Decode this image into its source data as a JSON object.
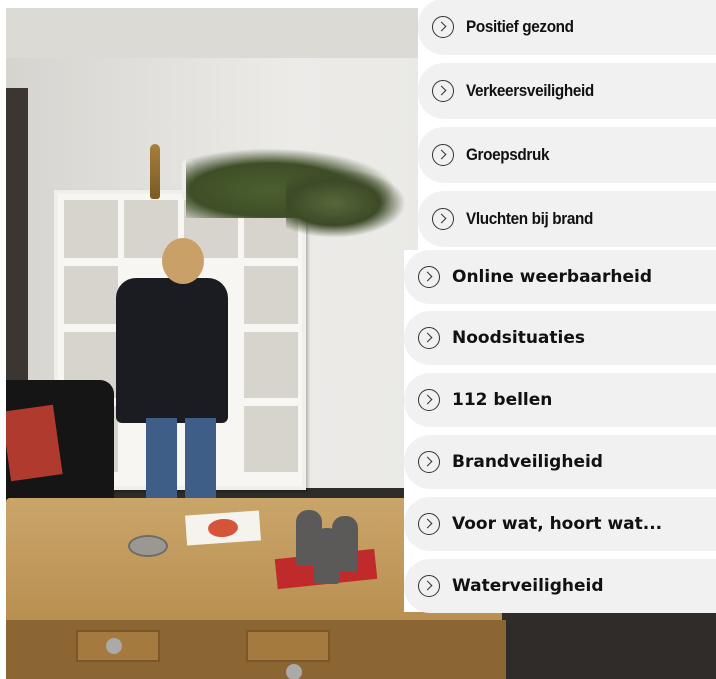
{
  "menu_top": {
    "items": [
      {
        "label": "Positief gezond",
        "icon": "chevron-right-circle-icon"
      },
      {
        "label": "Verkeersveiligheid",
        "icon": "chevron-right-circle-icon"
      },
      {
        "label": "Groepsdruk",
        "icon": "chevron-right-circle-icon"
      },
      {
        "label": "Vluchten bij brand",
        "icon": "chevron-right-circle-icon"
      }
    ]
  },
  "menu_bottom": {
    "items": [
      {
        "label": "Online weerbaarheid",
        "icon": "chevron-right-circle-icon"
      },
      {
        "label": "Noodsituaties",
        "icon": "chevron-right-circle-icon"
      },
      {
        "label": "112 bellen",
        "icon": "chevron-right-circle-icon"
      },
      {
        "label": "Brandveiligheid",
        "icon": "chevron-right-circle-icon"
      },
      {
        "label": "Voor wat, hoort wat...",
        "icon": "chevron-right-circle-icon"
      },
      {
        "label": "Waterveiligheid",
        "icon": "chevron-right-circle-icon"
      }
    ]
  },
  "colors": {
    "item_background": "#f1f1f1",
    "text": "#111111",
    "panel_background": "#ffffff"
  }
}
